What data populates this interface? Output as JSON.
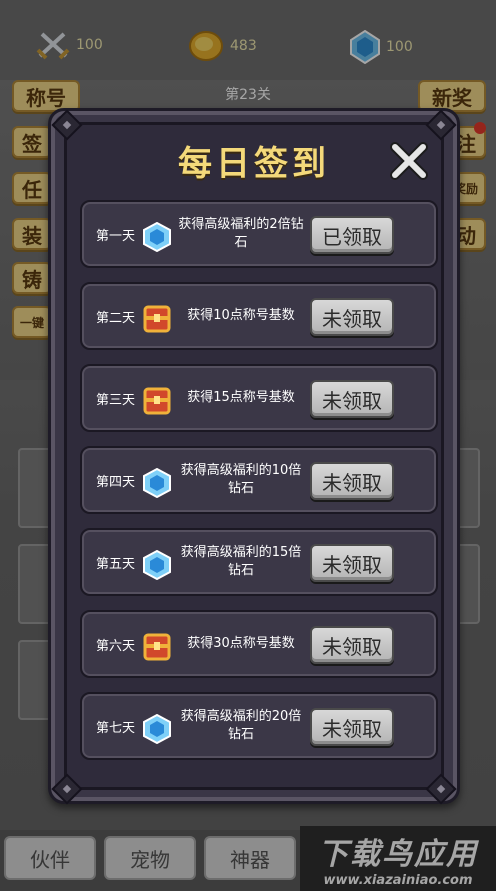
{
  "topbar": {
    "attack": "100",
    "gold": "483",
    "diamond": "100"
  },
  "stage": {
    "title": "第23关"
  },
  "left_menu": [
    "称号",
    "签",
    "任",
    "装",
    "铸",
    "一键"
  ],
  "right_menu": [
    "新奖",
    "注",
    "奖励",
    "动"
  ],
  "modal": {
    "title": "每日签到",
    "rows": [
      {
        "day": "第一天",
        "icon": "diamond-icon",
        "reward": "获得高级福利的2倍钻石",
        "button": "已领取"
      },
      {
        "day": "第二天",
        "icon": "chest-icon",
        "reward": "获得10点称号基数",
        "button": "未领取"
      },
      {
        "day": "第三天",
        "icon": "chest-icon",
        "reward": "获得15点称号基数",
        "button": "未领取"
      },
      {
        "day": "第四天",
        "icon": "diamond-icon",
        "reward": "获得高级福利的10倍钻石",
        "button": "未领取"
      },
      {
        "day": "第五天",
        "icon": "diamond-icon",
        "reward": "获得高级福利的15倍钻石",
        "button": "未领取"
      },
      {
        "day": "第六天",
        "icon": "chest-icon",
        "reward": "获得30点称号基数",
        "button": "未领取"
      },
      {
        "day": "第七天",
        "icon": "diamond-icon",
        "reward": "获得高级福利的20倍钻石",
        "button": "未领取"
      }
    ]
  },
  "bottom_nav": [
    "伙伴",
    "宠物",
    "神器"
  ],
  "watermark": {
    "title": "下载鸟应用",
    "url": "www.xiazainiao.com"
  },
  "colors": {
    "title_gold": "#f4d97a",
    "panel_dark": "#2f2b3b",
    "button_gray": "#c4c4c4",
    "side_button": "#f3d98a"
  }
}
